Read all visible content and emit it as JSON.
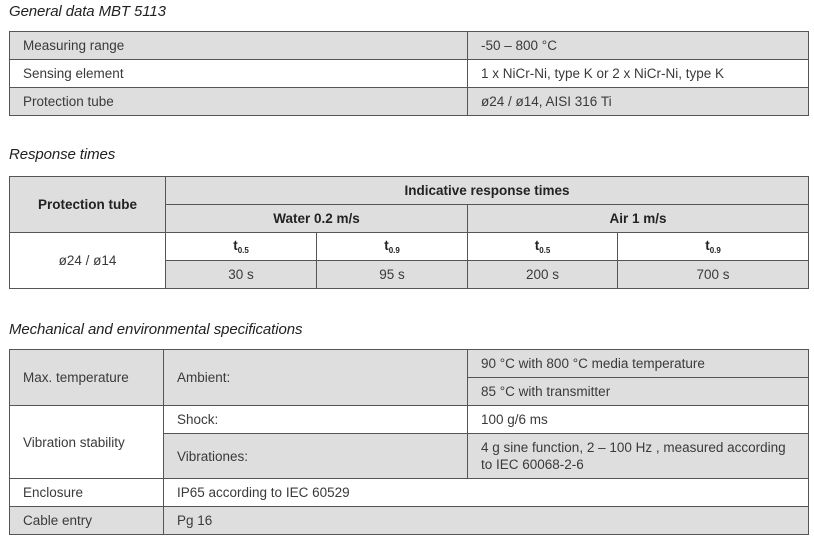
{
  "general": {
    "heading": "General data MBT 5113",
    "rows": [
      {
        "label": "Measuring range",
        "value": "-50 – 800 °C"
      },
      {
        "label": "Sensing element",
        "value": "1 x NiCr-Ni, type K or 2 x NiCr-Ni, type K"
      },
      {
        "label": "Protection tube",
        "value": "ø24 / ø14, AISI 316 Ti"
      }
    ]
  },
  "response": {
    "heading": "Response times",
    "col_header": "Protection tube",
    "group_header": "Indicative response times",
    "water_header": "Water 0.2 m/s",
    "air_header": "Air 1 m/s",
    "t_symbol": "t",
    "t05_sub": "0.5",
    "t09_sub": "0.9",
    "tube": "ø24 / ø14",
    "values": [
      "30 s",
      "95 s",
      "200 s",
      "700 s"
    ]
  },
  "mech": {
    "heading": "Mechanical and environmental specifications",
    "max_temp": {
      "label": "Max. temperature",
      "sublabel": "Ambient:",
      "value1": "90 °C with 800 °C media temperature",
      "value2": "85 °C with transmitter"
    },
    "vibration": {
      "label": "Vibration stability",
      "shock_label": "Shock:",
      "shock_value": "100 g/6 ms",
      "vib_label": "Vibrationes:",
      "vib_value": "4 g sine function, 2 – 100 Hz , measured according to IEC 60068-2-6"
    },
    "enclosure": {
      "label": "Enclosure",
      "value": "IP65 according to IEC 60529"
    },
    "cable": {
      "label": "Cable entry",
      "value": "Pg 16"
    }
  }
}
